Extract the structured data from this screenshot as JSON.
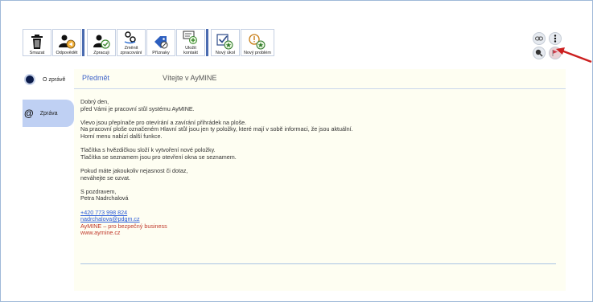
{
  "toolbar": {
    "delete": "Smazat",
    "reply": "Odpovědět",
    "working": "Zpracuji",
    "change_processing": "Změnit\nzpracování",
    "flags": "Příznaky",
    "save_contact": "Uložit\nkontakt",
    "new_task": "Nový úkol",
    "new_problem": "Nový problém"
  },
  "sidebar": {
    "items": [
      {
        "label": "O zprávě"
      },
      {
        "label": "Zpráva"
      }
    ]
  },
  "message": {
    "subject_label": "Předmět",
    "subject": "Vítejte v AyMINE",
    "greeting_1": "Dobrý den,",
    "greeting_2": "před Vámi je pracovní stůl systému AyMINE.",
    "p2_1": "Vlevo jsou přepínače pro otevírání a zavírání přihrádek na ploše.",
    "p2_2": "Na pracovní ploše označeném Hlavní stůl jsou jen ty položky, které mají v sobě informaci, že jsou aktuální.",
    "p2_3": "Horní menu nabízí další funkce.",
    "p3_1": "Tlačítka s hvězdičkou složí k vytvoření nové položky.",
    "p3_2": "Tlačítka se seznamem jsou pro otevření okna se seznamem.",
    "p4_1": "Pokud máte jakoukoliv nejasnost či dotaz,",
    "p4_2": "neváhejte se ozvat.",
    "sig_1": "S pozdravem,",
    "sig_2": "Petra Nadrchalová",
    "phone": "+420 773 998 824",
    "email": "nadrchalova@pdgm.cz",
    "company": "AyMINE – pro bezpečný business",
    "web": "www.aymine.cz"
  },
  "colors": {
    "accent": "#3f63c8",
    "sidebar_active": "#bfd0f3",
    "content_bg": "#fefef2",
    "arrow": "#cc1f1f"
  }
}
